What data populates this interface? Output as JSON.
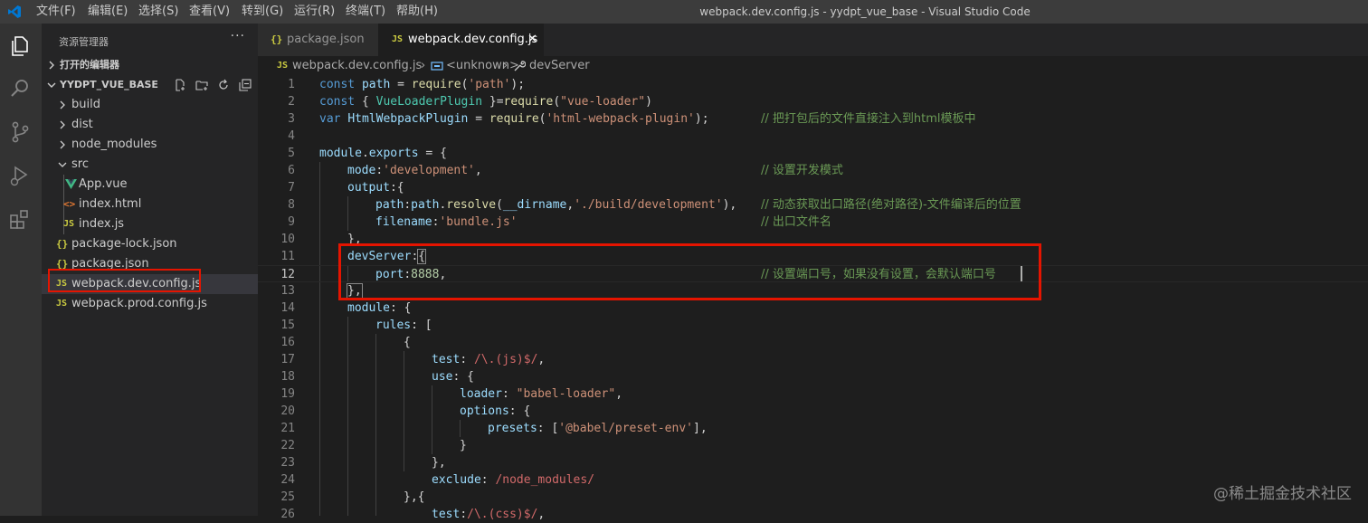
{
  "colors": {
    "titlebar_bg": "#3c3c3c",
    "activitybar_bg": "#333333",
    "sidebar_bg": "#252526",
    "editor_bg": "#1e1e1e",
    "highlight_border": "#e51400",
    "keyword": "#569cd6",
    "string": "#ce9178",
    "comment": "#6a9955",
    "property": "#9cdcfe"
  },
  "titlebar": {
    "menu": [
      "文件(F)",
      "编辑(E)",
      "选择(S)",
      "查看(V)",
      "转到(G)",
      "运行(R)",
      "终端(T)",
      "帮助(H)"
    ],
    "window_title": "webpack.dev.config.js - yydpt_vue_base - Visual Studio Code"
  },
  "activitybar": {
    "icons": [
      "explorer-icon",
      "search-icon",
      "source-control-icon",
      "run-debug-icon",
      "extensions-icon"
    ]
  },
  "sidebar": {
    "title": "资源管理器",
    "more": "···",
    "open_editors": "打开的编辑器",
    "project": "YYDPT_VUE_BASE",
    "items": [
      {
        "label": "build",
        "kind": "folder",
        "icon": "chevron-right-icon"
      },
      {
        "label": "dist",
        "kind": "folder",
        "icon": "chevron-right-icon"
      },
      {
        "label": "node_modules",
        "kind": "folder",
        "icon": "chevron-right-icon"
      },
      {
        "label": "src",
        "kind": "folder-open",
        "icon": "chevron-down-icon"
      },
      {
        "label": "App.vue",
        "kind": "vue",
        "icon": "vue-file-icon"
      },
      {
        "label": "index.html",
        "kind": "html",
        "icon": "html-file-icon"
      },
      {
        "label": "index.js",
        "kind": "js",
        "icon": "js-file-icon"
      },
      {
        "label": "package-lock.json",
        "kind": "json",
        "icon": "json-file-icon"
      },
      {
        "label": "package.json",
        "kind": "json",
        "icon": "json-file-icon"
      },
      {
        "label": "webpack.dev.config.js",
        "kind": "js",
        "icon": "js-file-icon"
      },
      {
        "label": "webpack.prod.config.js",
        "kind": "js",
        "icon": "js-file-icon"
      }
    ],
    "file_icon_text": {
      "js": "JS",
      "json": "{}",
      "html": "<>"
    }
  },
  "tabs": [
    {
      "label": "package.json",
      "icon": "{}",
      "active": false
    },
    {
      "label": "webpack.dev.config.js",
      "icon": "JS",
      "active": true
    }
  ],
  "tab_close": "✕",
  "breadcrumb": {
    "file": "webpack.dev.config.js",
    "symbol1": "<unknown>",
    "symbol2": "devServer",
    "js_icon": "JS",
    "sep": "›"
  },
  "code": {
    "line_numbers": [
      "1",
      "2",
      "3",
      "4",
      "5",
      "6",
      "7",
      "8",
      "9",
      "10",
      "11",
      "12",
      "13",
      "14",
      "15",
      "16",
      "17",
      "18",
      "19",
      "20",
      "21",
      "22",
      "23",
      "24",
      "25",
      "26"
    ],
    "t": {
      "const": "const",
      "var": "var",
      "path": "path",
      "eq": " = ",
      "require": "require",
      "s_path": "'path'",
      "semi": ";",
      "op": "(",
      "cp": ")",
      "lb": "{ ",
      "rb": " }",
      "VueLoaderPlugin": "VueLoaderPlugin",
      "eqn": "=",
      "s_vueloader": "\"vue-loader\"",
      "HtmlWebpackPlugin": "HtmlWebpackPlugin",
      "s_hwp": "'html-webpack-plugin'",
      "c3": "// 把打包后的文件直接注入到html模板中",
      "module": "module",
      "dot": ".",
      "exports": "exports",
      "ob": "{",
      "mode": "mode",
      "colon": ":",
      "s_dev": "'development'",
      "comma": ",",
      "c6": "// 设置开发模式",
      "output": "output",
      "resolve": "resolve",
      "dirname": "__dirname",
      "s_builddev": "'./build/development'",
      "c8": "// 动态获取出口路径(绝对路径)-文件编译后的位置",
      "filename": "filename",
      "s_bundle": "'bundle.js'",
      "c9": "// 出口文件名",
      "cbc": "},",
      "devServer": "devServer",
      "port": "port",
      "n8888": "8888",
      "c12": "// 设置端口号，如果没有设置，会默认端口号",
      "rules": "rules",
      "obr": "[",
      "test": "test",
      "rx_js": "/\\.(js)$/",
      "use": "use",
      "loader": "loader",
      "s_babel": "\"babel-loader\"",
      "options": "options",
      "presets": "presets",
      "s_preset": "'@babel/preset-env'",
      "cbr": "]",
      "cb": "}",
      "exclude": "exclude",
      "rx_nm": "/node_modules/",
      "cbcob": "},{",
      "rx_css": "/\\.(css)$/",
      "colsp": ": "
    }
  },
  "watermark": "@稀土掘金技术社区"
}
